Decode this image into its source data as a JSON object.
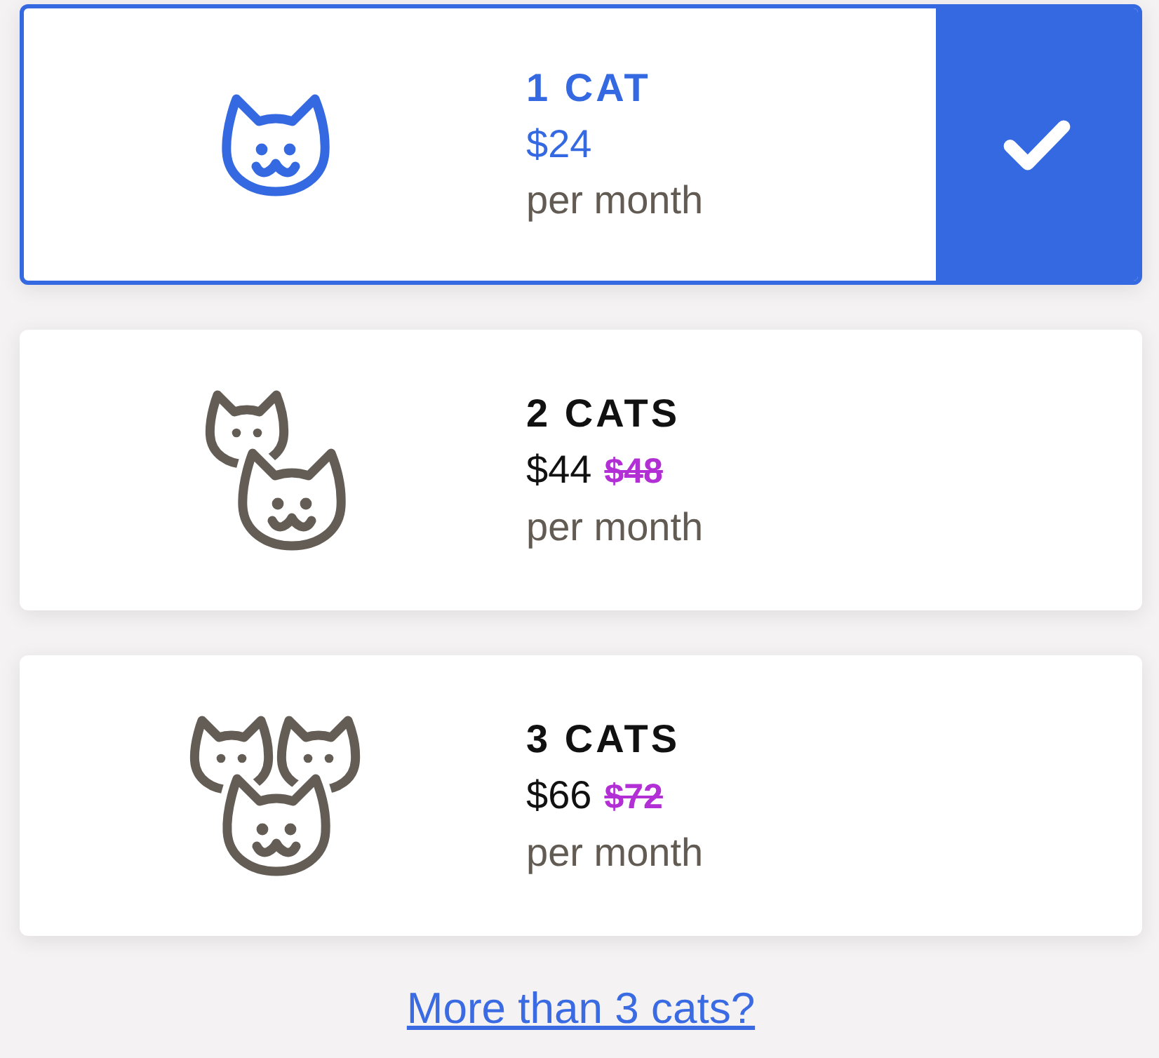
{
  "plans": [
    {
      "kind": "single",
      "title": "1 CAT",
      "price": "$24",
      "period": "per month",
      "selected": true
    },
    {
      "kind": "pair",
      "title": "2 CATS",
      "price": "$44",
      "original_price": "$48",
      "period": "per month",
      "selected": false
    },
    {
      "kind": "trio",
      "title": "3 CATS",
      "price": "$66",
      "original_price": "$72",
      "period": "per month",
      "selected": false
    }
  ],
  "more_link": "More than 3 cats?"
}
